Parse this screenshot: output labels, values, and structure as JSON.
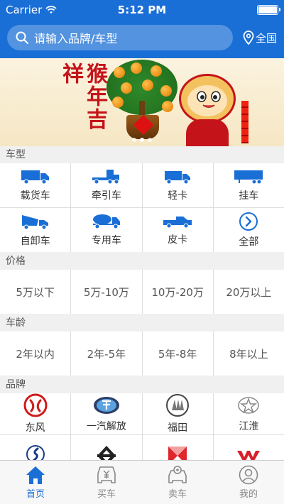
{
  "status_bar": {
    "carrier": "Carrier",
    "time": "5:12 PM"
  },
  "search": {
    "placeholder": "请输入品牌/车型"
  },
  "location": {
    "label": "全国"
  },
  "banner": {
    "text": "猴年吉祥",
    "dots": 3,
    "active_dot": 2
  },
  "sections": {
    "vehicle_type": {
      "title": "车型",
      "items": [
        {
          "label": "载货车",
          "icon": "cargo-truck-icon"
        },
        {
          "label": "牵引车",
          "icon": "tractor-truck-icon"
        },
        {
          "label": "轻卡",
          "icon": "light-truck-icon"
        },
        {
          "label": "挂车",
          "icon": "trailer-icon"
        },
        {
          "label": "自卸车",
          "icon": "dump-truck-icon"
        },
        {
          "label": "专用车",
          "icon": "special-truck-icon"
        },
        {
          "label": "皮卡",
          "icon": "pickup-icon"
        },
        {
          "label": "全部",
          "icon": "arrow-right-circle-icon"
        }
      ]
    },
    "price": {
      "title": "价格",
      "items": [
        "5万以下",
        "5万-10万",
        "10万-20万",
        "20万以上"
      ]
    },
    "age": {
      "title": "车龄",
      "items": [
        "2年以内",
        "2年-5年",
        "5年-8年",
        "8年以上"
      ]
    },
    "brand": {
      "title": "品牌",
      "items": [
        {
          "label": "东风",
          "icon": "dongfeng-logo-icon"
        },
        {
          "label": "一汽解放",
          "icon": "faw-jiefang-logo-icon"
        },
        {
          "label": "福田",
          "icon": "foton-logo-icon"
        },
        {
          "label": "江淮",
          "icon": "jac-logo-icon"
        },
        {
          "label": "",
          "icon": "shacman-logo-icon"
        },
        {
          "label": "",
          "icon": "cnhtc-logo-icon"
        },
        {
          "label": "",
          "icon": "hongyan-logo-icon"
        },
        {
          "label": "",
          "icon": "wuling-logo-icon"
        }
      ]
    }
  },
  "tabbar": {
    "tabs": [
      {
        "label": "首页",
        "icon": "home-icon",
        "active": true
      },
      {
        "label": "买车",
        "icon": "buy-car-icon",
        "active": false
      },
      {
        "label": "卖车",
        "icon": "sell-car-icon",
        "active": false
      },
      {
        "label": "我的",
        "icon": "profile-icon",
        "active": false
      }
    ]
  },
  "colors": {
    "primary": "#1a6fd6",
    "banner_red": "#c4141a"
  }
}
